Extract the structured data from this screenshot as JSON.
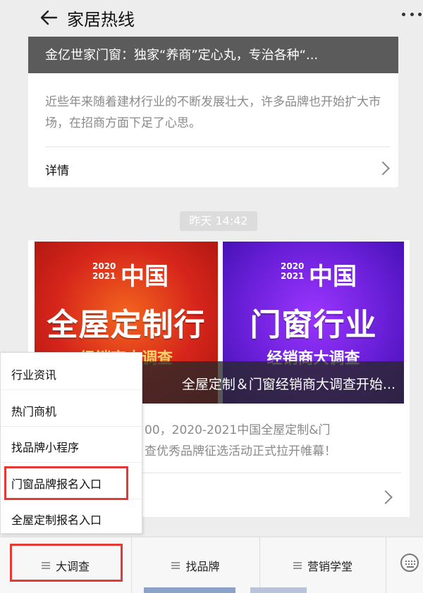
{
  "header": {
    "title": "家居热线"
  },
  "card1": {
    "banner_title": "金亿世家门窗：独家“养商”定心丸，专治各种“...",
    "description": "近些年来随着建材行业的不断发展壮大，许多品牌也开始扩大市场，在招商方面下足了心思。",
    "detail_label": "详情"
  },
  "timestamp": "昨天 14:42",
  "card2": {
    "poster_left": {
      "year_top": "2020",
      "year_bottom": "2021",
      "country": "中国",
      "headline": "全屋定制行业",
      "subhead": "经销商大调查"
    },
    "poster_right": {
      "year_top": "2020",
      "year_bottom": "2021",
      "country": "中国",
      "headline": "门窗行业",
      "subhead": "经销商大调查"
    },
    "caption": "全屋定制＆门窗经销商大调查开始...",
    "description_line1": "00，2020-2021中国全屋定制&门",
    "description_line2": "查优秀品牌征选活动正式拉开帷幕！"
  },
  "popup_menu": {
    "items": [
      "行业资讯",
      "热门商机",
      "找品牌小程序",
      "门窗品牌报名入口",
      "全屋定制报名入口"
    ]
  },
  "bottom_bar": {
    "tabs": [
      "大调查",
      "找品牌",
      "营销学堂"
    ],
    "keyboard_icon": "keyboard-icon"
  },
  "colors": {
    "highlight": "#e53935",
    "background": "#ededed"
  }
}
